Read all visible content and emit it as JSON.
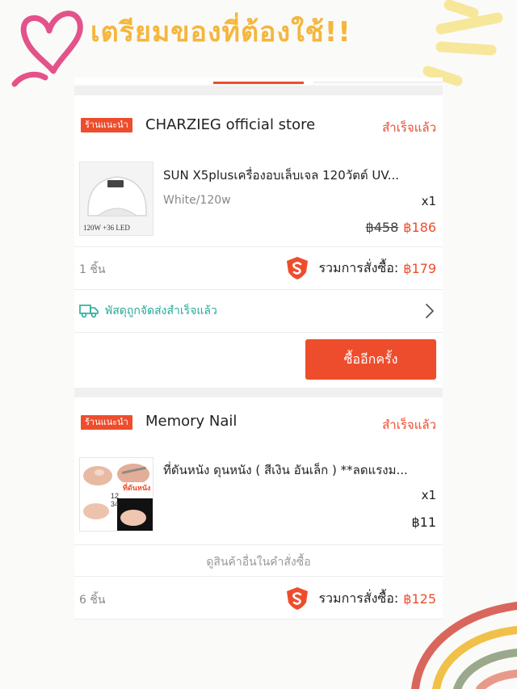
{
  "header": {
    "title": "เตรียมของที่ต้องใช้!!"
  },
  "orders": [
    {
      "badge": "ร้านแนะนำ",
      "shop_name": "CHARZIEG official store",
      "status": "สำเร็จแล้ว",
      "product": {
        "name": "SUN X5plusเครื่องอบเล็บเจล 120วัตต์ UV...",
        "variant": "White/120w",
        "qty": "x1",
        "old_price": "฿458",
        "price": "฿186",
        "thumb_caption": "120W +36 LED"
      },
      "item_count": "1 ชิ้น",
      "total_label": "รวมการสั่งซื้อ:",
      "total_value": "฿179",
      "shipping_status": "พัสดุถูกจัดส่งสำเร็จแล้ว",
      "buy_again": "ซื้ออีกครั้ง"
    },
    {
      "badge": "ร้านแนะนำ",
      "shop_name": "Memory Nail",
      "status": "สำเร็จแล้ว",
      "product": {
        "name": "ที่ดันหนัง ดุนหนัง ( สีเงิน อันเล็ก ) **ลดแรงม...",
        "qty": "x1",
        "price": "฿11",
        "thumb_caption": "ที่ดันหนัง"
      },
      "view_more": "ดูสินค้าอื่นในคำสั่งซื้อ",
      "item_count": "6 ชิ้น",
      "total_label": "รวมการสั่งซื้อ:",
      "total_value": "฿125"
    }
  ],
  "colors": {
    "accent": "#ee4d2d",
    "teal": "#26aa99",
    "title": "#f5b63c"
  },
  "icons": [
    "shopee-logo-icon",
    "truck-icon",
    "chevron-right-icon",
    "heart-doodle-icon"
  ]
}
